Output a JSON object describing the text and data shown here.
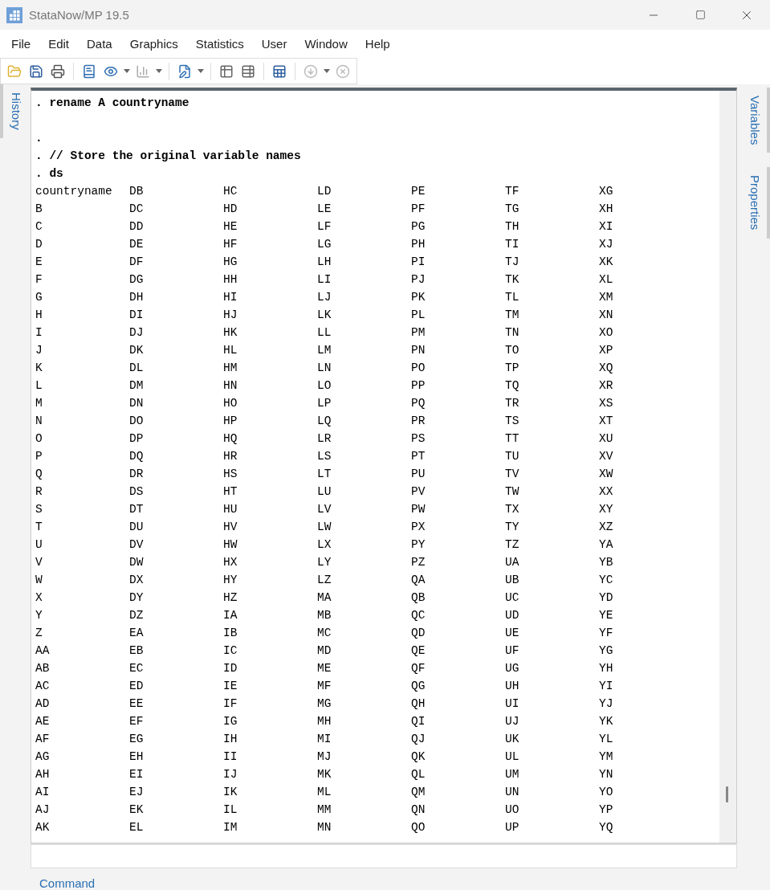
{
  "window": {
    "title": "StataNow/MP 19.5"
  },
  "menu": [
    "File",
    "Edit",
    "Data",
    "Graphics",
    "Statistics",
    "User",
    "Window",
    "Help"
  ],
  "left_tabs": [
    {
      "label": "History",
      "selected": false
    }
  ],
  "right_tabs": [
    {
      "label": "Variables",
      "selected": false
    },
    {
      "label": "Properties",
      "selected": false
    }
  ],
  "results": {
    "lines": [
      {
        "kind": "command",
        "text": ". rename A countryname"
      },
      {
        "kind": "blank"
      },
      {
        "kind": "command",
        "text": "."
      },
      {
        "kind": "command",
        "text": ". // Store the original variable names"
      },
      {
        "kind": "command",
        "text": ". ds"
      }
    ],
    "rows": [
      [
        "countryname",
        "DB",
        "HC",
        "LD",
        "PE",
        "TF",
        "XG"
      ],
      [
        "B",
        "DC",
        "HD",
        "LE",
        "PF",
        "TG",
        "XH"
      ],
      [
        "C",
        "DD",
        "HE",
        "LF",
        "PG",
        "TH",
        "XI"
      ],
      [
        "D",
        "DE",
        "HF",
        "LG",
        "PH",
        "TI",
        "XJ"
      ],
      [
        "E",
        "DF",
        "HG",
        "LH",
        "PI",
        "TJ",
        "XK"
      ],
      [
        "F",
        "DG",
        "HH",
        "LI",
        "PJ",
        "TK",
        "XL"
      ],
      [
        "G",
        "DH",
        "HI",
        "LJ",
        "PK",
        "TL",
        "XM"
      ],
      [
        "H",
        "DI",
        "HJ",
        "LK",
        "PL",
        "TM",
        "XN"
      ],
      [
        "I",
        "DJ",
        "HK",
        "LL",
        "PM",
        "TN",
        "XO"
      ],
      [
        "J",
        "DK",
        "HL",
        "LM",
        "PN",
        "TO",
        "XP"
      ],
      [
        "K",
        "DL",
        "HM",
        "LN",
        "PO",
        "TP",
        "XQ"
      ],
      [
        "L",
        "DM",
        "HN",
        "LO",
        "PP",
        "TQ",
        "XR"
      ],
      [
        "M",
        "DN",
        "HO",
        "LP",
        "PQ",
        "TR",
        "XS"
      ],
      [
        "N",
        "DO",
        "HP",
        "LQ",
        "PR",
        "TS",
        "XT"
      ],
      [
        "O",
        "DP",
        "HQ",
        "LR",
        "PS",
        "TT",
        "XU"
      ],
      [
        "P",
        "DQ",
        "HR",
        "LS",
        "PT",
        "TU",
        "XV"
      ],
      [
        "Q",
        "DR",
        "HS",
        "LT",
        "PU",
        "TV",
        "XW"
      ],
      [
        "R",
        "DS",
        "HT",
        "LU",
        "PV",
        "TW",
        "XX"
      ],
      [
        "S",
        "DT",
        "HU",
        "LV",
        "PW",
        "TX",
        "XY"
      ],
      [
        "T",
        "DU",
        "HV",
        "LW",
        "PX",
        "TY",
        "XZ"
      ],
      [
        "U",
        "DV",
        "HW",
        "LX",
        "PY",
        "TZ",
        "YA"
      ],
      [
        "V",
        "DW",
        "HX",
        "LY",
        "PZ",
        "UA",
        "YB"
      ],
      [
        "W",
        "DX",
        "HY",
        "LZ",
        "QA",
        "UB",
        "YC"
      ],
      [
        "X",
        "DY",
        "HZ",
        "MA",
        "QB",
        "UC",
        "YD"
      ],
      [
        "Y",
        "DZ",
        "IA",
        "MB",
        "QC",
        "UD",
        "YE"
      ],
      [
        "Z",
        "EA",
        "IB",
        "MC",
        "QD",
        "UE",
        "YF"
      ],
      [
        "AA",
        "EB",
        "IC",
        "MD",
        "QE",
        "UF",
        "YG"
      ],
      [
        "AB",
        "EC",
        "ID",
        "ME",
        "QF",
        "UG",
        "YH"
      ],
      [
        "AC",
        "ED",
        "IE",
        "MF",
        "QG",
        "UH",
        "YI"
      ],
      [
        "AD",
        "EE",
        "IF",
        "MG",
        "QH",
        "UI",
        "YJ"
      ],
      [
        "AE",
        "EF",
        "IG",
        "MH",
        "QI",
        "UJ",
        "YK"
      ],
      [
        "AF",
        "EG",
        "IH",
        "MI",
        "QJ",
        "UK",
        "YL"
      ],
      [
        "AG",
        "EH",
        "II",
        "MJ",
        "QK",
        "UL",
        "YM"
      ],
      [
        "AH",
        "EI",
        "IJ",
        "MK",
        "QL",
        "UM",
        "YN"
      ],
      [
        "AI",
        "EJ",
        "IK",
        "ML",
        "QM",
        "UN",
        "YO"
      ],
      [
        "AJ",
        "EK",
        "IL",
        "MM",
        "QN",
        "UO",
        "YP"
      ],
      [
        "AK",
        "EL",
        "IM",
        "MN",
        "QO",
        "UP",
        "YQ"
      ]
    ]
  },
  "command": {
    "label": "Command"
  }
}
